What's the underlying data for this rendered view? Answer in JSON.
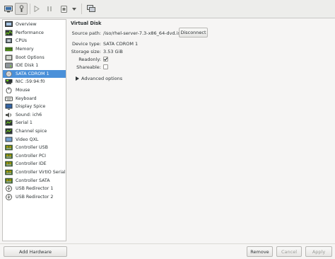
{
  "toolbar": {
    "buttons": [
      {
        "name": "console-icon"
      },
      {
        "name": "details-icon"
      },
      {
        "name": "play-icon"
      },
      {
        "name": "pause-icon"
      },
      {
        "name": "shutdown-icon"
      },
      {
        "name": "chevron-down-icon"
      },
      {
        "name": "fullscreen-icon"
      }
    ]
  },
  "sidebar": {
    "items": [
      {
        "label": "Overview",
        "icon": "overview-icon"
      },
      {
        "label": "Performance",
        "icon": "performance-icon"
      },
      {
        "label": "CPUs",
        "icon": "cpu-icon"
      },
      {
        "label": "Memory",
        "icon": "memory-icon"
      },
      {
        "label": "Boot Options",
        "icon": "boot-options-icon"
      },
      {
        "label": "IDE Disk 1",
        "icon": "disk-icon"
      },
      {
        "label": "SATA CDROM 1",
        "icon": "cdrom-icon",
        "selected": true
      },
      {
        "label": "NIC :59:94:f0",
        "icon": "nic-icon"
      },
      {
        "label": "Mouse",
        "icon": "mouse-icon"
      },
      {
        "label": "Keyboard",
        "icon": "keyboard-icon"
      },
      {
        "label": "Display Spice",
        "icon": "display-icon"
      },
      {
        "label": "Sound: ich6",
        "icon": "sound-icon"
      },
      {
        "label": "Serial 1",
        "icon": "serial-icon"
      },
      {
        "label": "Channel spice",
        "icon": "channel-icon"
      },
      {
        "label": "Video QXL",
        "icon": "video-icon"
      },
      {
        "label": "Controller USB",
        "icon": "controller-icon"
      },
      {
        "label": "Controller PCI",
        "icon": "controller-icon"
      },
      {
        "label": "Controller IDE",
        "icon": "controller-icon"
      },
      {
        "label": "Controller VirtIO Serial",
        "icon": "controller-icon"
      },
      {
        "label": "Controller SATA",
        "icon": "controller-icon"
      },
      {
        "label": "USB Redirector 1",
        "icon": "usb-redirector-icon"
      },
      {
        "label": "USB Redirector 2",
        "icon": "usb-redirector-icon"
      }
    ],
    "add_hardware": "Add Hardware"
  },
  "details": {
    "title": "Virtual Disk",
    "source_path_label": "Source path:",
    "source_path_value": "/iso/rhel-server-7.3-x86_64-dvd.iso",
    "disconnect": "Disconnect",
    "device_type_label": "Device type:",
    "device_type_value": "SATA CDROM 1",
    "storage_size_label": "Storage size:",
    "storage_size_value": "3.53 GiB",
    "readonly_label": "Readonly:",
    "readonly_checked": true,
    "shareable_label": "Shareable:",
    "shareable_checked": false,
    "advanced_label": "Advanced options"
  },
  "footer": {
    "remove": "Remove",
    "cancel": "Cancel",
    "apply": "Apply"
  },
  "colors": {
    "selection": "#4a90d9",
    "window_bg": "#f6f5f4"
  }
}
